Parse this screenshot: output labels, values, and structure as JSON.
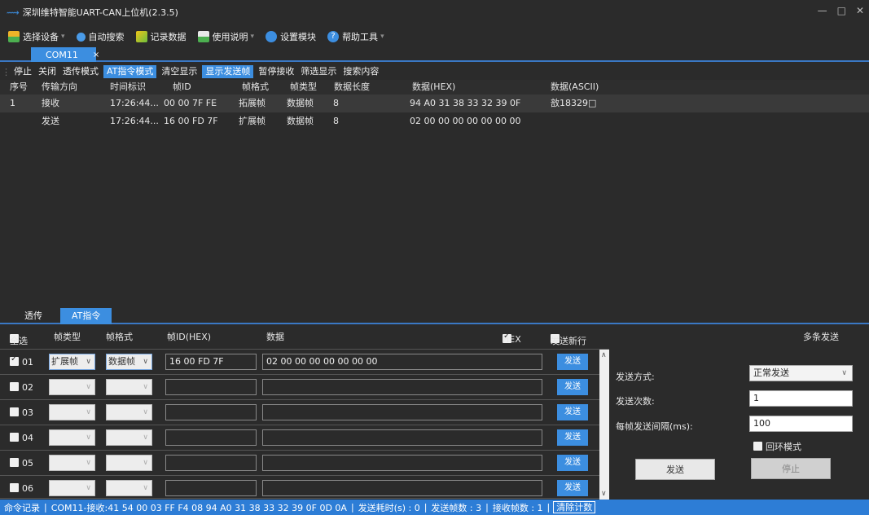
{
  "window": {
    "title": "深圳维特智能UART-CAN上位机(2.3.5)"
  },
  "menu": [
    {
      "label": "选择设备",
      "icon": "device-icon",
      "has_caret": true
    },
    {
      "label": "自动搜索",
      "icon": "search-icon",
      "has_caret": false
    },
    {
      "label": "记录数据",
      "icon": "record-icon",
      "has_caret": false
    },
    {
      "label": "使用说明",
      "icon": "manual-icon",
      "has_caret": true
    },
    {
      "label": "设置模块",
      "icon": "settings-icon",
      "has_caret": false
    },
    {
      "label": "帮助工具",
      "icon": "help-icon",
      "has_caret": true
    }
  ],
  "doc_tab": {
    "label": "COM11",
    "close": "×"
  },
  "toolbar": [
    {
      "label": "停止",
      "active": false
    },
    {
      "label": "关闭",
      "active": false
    },
    {
      "label": "透传模式",
      "active": false
    },
    {
      "label": "AT指令模式",
      "active": true
    },
    {
      "label": "清空显示",
      "active": false
    },
    {
      "label": "显示发送帧",
      "active": true
    },
    {
      "label": "暂停接收",
      "active": false
    },
    {
      "label": "筛选显示",
      "active": false
    },
    {
      "label": "搜索内容",
      "active": false
    }
  ],
  "grid": {
    "headers": [
      "序号",
      "传输方向",
      "时间标识",
      "帧ID",
      "帧格式",
      "帧类型",
      "数据长度",
      "数据(HEX)",
      "数据(ASCII)"
    ],
    "rows": [
      [
        "1",
        "接收",
        "17:26:44...",
        "00 00 7F FE",
        "拓展帧",
        "数据帧",
        "8",
        "94 A0 31 38 33 32 39 0F",
        "敨18329□"
      ],
      [
        "",
        "发送",
        "17:26:44...",
        "16 00 FD 7F",
        "扩展帧",
        "数据帧",
        "8",
        "02 00 00 00 00 00 00 00",
        ""
      ]
    ]
  },
  "subtabs": [
    {
      "label": "透传",
      "active": false
    },
    {
      "label": "AT指令",
      "active": true
    }
  ],
  "at_header": {
    "select_all": "全选",
    "frame_type": "帧类型",
    "frame_format": "帧格式",
    "frame_id": "帧ID(HEX)",
    "data": "数据",
    "hex": "HEX",
    "hex_checked": true,
    "newline": "发送新行",
    "newline_checked": false,
    "multi": "多条发送"
  },
  "at_rows": [
    {
      "num": "01",
      "checked": true,
      "type": "扩展帧",
      "format": "数据帧",
      "id": "16 00 FD 7F",
      "data": "02 00 00 00 00 00 00 00",
      "send": "发送"
    },
    {
      "num": "02",
      "checked": false,
      "type": "",
      "format": "",
      "id": "",
      "data": "",
      "send": "发送"
    },
    {
      "num": "03",
      "checked": false,
      "type": "",
      "format": "",
      "id": "",
      "data": "",
      "send": "发送"
    },
    {
      "num": "04",
      "checked": false,
      "type": "",
      "format": "",
      "id": "",
      "data": "",
      "send": "发送"
    },
    {
      "num": "05",
      "checked": false,
      "type": "",
      "format": "",
      "id": "",
      "data": "",
      "send": "发送"
    },
    {
      "num": "06",
      "checked": false,
      "type": "",
      "format": "",
      "id": "",
      "data": "",
      "send": "发送"
    }
  ],
  "right_panel": {
    "mode_label": "发送方式:",
    "mode_value": "正常发送",
    "count_label": "发送次数:",
    "count_value": "1",
    "interval_label": "每帧发送间隔(ms):",
    "interval_value": "100",
    "loop_label": "回环模式",
    "loop_checked": false,
    "send_button": "发送",
    "stop_button": "停止"
  },
  "statusbar": {
    "cmd": "命令记录",
    "recv": "COM11-接收:41 54 00 03 FF F4 08 94 A0 31 38 33 32 39 0F 0D 0A",
    "elapsed": "发送耗时(s) :   0",
    "sent": "发送帧数 :     3",
    "rcvd": "接收帧数 :     1",
    "clear": "清除计数"
  },
  "colors": {
    "accent": "#3c8ee0",
    "background": "#2b2b2b",
    "statusbar": "#2d7dd6"
  }
}
